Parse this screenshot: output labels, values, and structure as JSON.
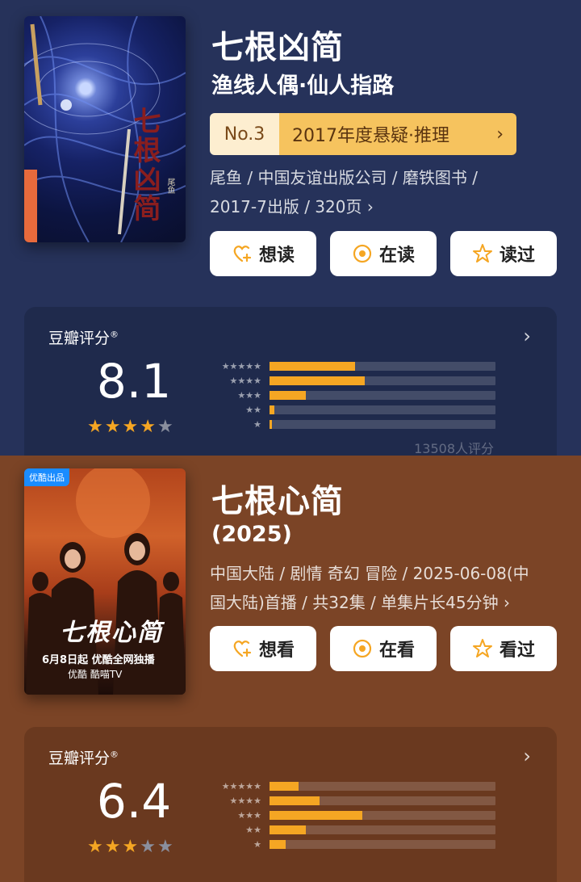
{
  "book": {
    "title": "七根凶简",
    "subtitle": "渔线人偶·仙人指路",
    "cover": {
      "vertical_title": "七根凶简",
      "author_tag": "尾鱼"
    },
    "rank": {
      "no": "No.3",
      "category": "2017年度悬疑·推理",
      "chevron": "›"
    },
    "meta_line1": "尾鱼 / 中国友谊出版公司 / 磨铁图书 /",
    "meta_line2": "2017-7出版 / 320页 ›",
    "buttons": [
      {
        "label": "想读",
        "icon": "heart-plus-icon"
      },
      {
        "label": "在读",
        "icon": "target-icon"
      },
      {
        "label": "读过",
        "icon": "star-outline-icon"
      }
    ],
    "rating": {
      "label": "豆瓣评分",
      "mark": "®",
      "chevron": "›",
      "score": "8.1",
      "stars": 4,
      "distribution": [
        0.38,
        0.42,
        0.16,
        0.02,
        0.01
      ],
      "votes": "13508人评分"
    }
  },
  "drama": {
    "title": "七根心简",
    "subtitle": "(2025)",
    "cover": {
      "badge": "优酷出品",
      "poster_title": "七根心简",
      "premiere": "6月8日起 优酷全网独播",
      "platform": "优酷  酷喵TV"
    },
    "meta_line1": "中国大陆 / 剧情 奇幻 冒险 / 2025-06-08(中",
    "meta_line2": "国大陆)首播 / 共32集 / 单集片长45分钟 ›",
    "buttons": [
      {
        "label": "想看",
        "icon": "heart-plus-icon"
      },
      {
        "label": "在看",
        "icon": "target-icon"
      },
      {
        "label": "看过",
        "icon": "star-outline-icon"
      }
    ],
    "rating": {
      "label": "豆瓣评分",
      "mark": "®",
      "chevron": "›",
      "score": "6.4",
      "stars": 3,
      "distribution": [
        0.13,
        0.22,
        0.41,
        0.16,
        0.07
      ]
    }
  },
  "colors": {
    "book_bg": "#26325a",
    "drama_bg": "#7b4426",
    "bar_fill": "#f5a623",
    "star_on": "#f5a623",
    "star_off": "#8a8f9e"
  }
}
